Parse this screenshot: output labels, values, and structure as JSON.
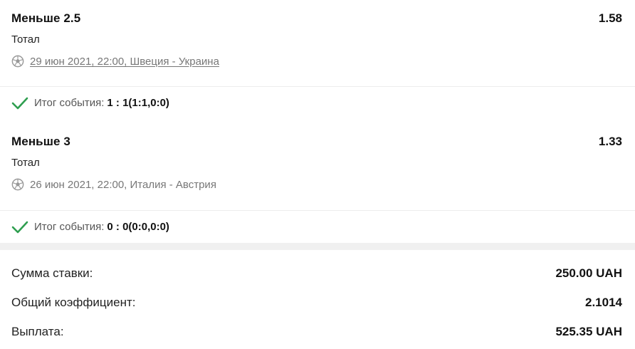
{
  "bets": [
    {
      "name": "Меньше 2.5",
      "odd": "1.58",
      "market": "Тотал",
      "event": "29 июн 2021, 22:00, Швеция - Украина",
      "event_link": true,
      "result_label": "Итог события:",
      "result_score": "1 : 1(1:1,0:0)"
    },
    {
      "name": "Меньше 3",
      "odd": "1.33",
      "market": "Тотал",
      "event": "26 июн 2021, 22:00, Италия - Австрия",
      "event_link": false,
      "result_label": "Итог события:",
      "result_score": "0 : 0(0:0,0:0)"
    }
  ],
  "summary": {
    "stake_label": "Сумма ставки:",
    "stake_value": "250.00 UAH",
    "total_odd_label": "Общий коэффициент:",
    "total_odd_value": "2.1014",
    "payout_label": "Выплата:",
    "payout_value": "525.35 UAH"
  },
  "icons": {
    "sport": "soccer-ball-icon",
    "result": "check-icon"
  },
  "colors": {
    "check": "#2e9e4f",
    "muted_text": "#777777",
    "band": "#f0f0f0"
  }
}
